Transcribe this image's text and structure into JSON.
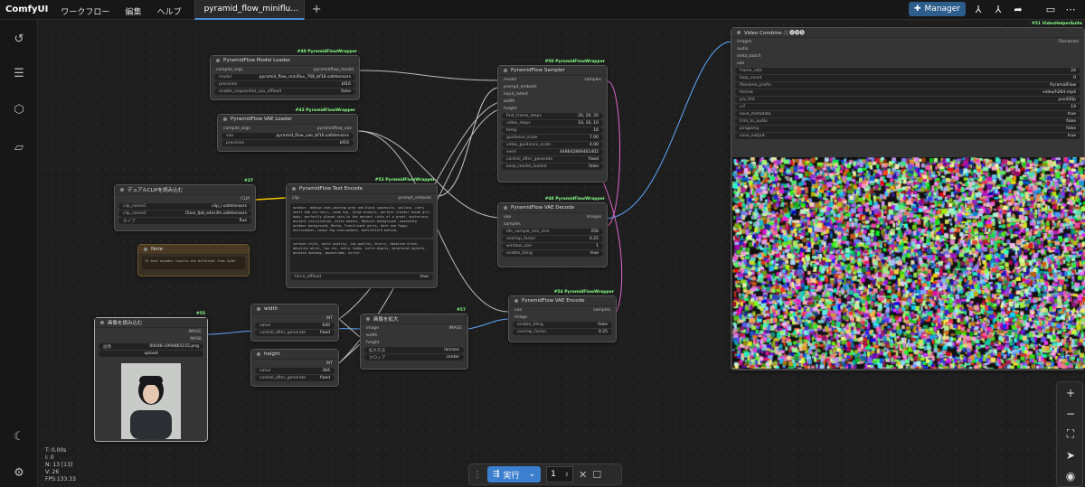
{
  "app": {
    "logo": "ComfyUI",
    "menu": [
      "ワークフロー",
      "編集",
      "ヘルプ"
    ],
    "tab": "pyramid_flow_miniflu…",
    "manager": "Manager"
  },
  "stats": {
    "t": "T: 0.00s",
    "i": "I: 0",
    "n": "N: 13 [13]",
    "v": "V: 26",
    "fps": "FPS:133.33"
  },
  "run": {
    "label": "実行",
    "count": "1"
  },
  "nodes": {
    "model_loader": {
      "badge": "#40 PyramidFlowWrapper",
      "title": "PyramidFlow Model Loader",
      "in": "compile_args",
      "out": "pyramidflow_model",
      "w": [
        [
          "model",
          "pyramid_flow_miniflux_768_bf16.safetensors"
        ],
        [
          "precision",
          "bf16"
        ],
        [
          "enable_sequential_cpu_offload",
          "false"
        ]
      ]
    },
    "vae_loader": {
      "badge": "#43 PyramidFlowWrapper",
      "title": "PyramidFlow VAE Loader",
      "in": "compile_args",
      "out": "pyramidflow_vae",
      "w": [
        [
          "vae",
          "pyramid_flow_vae_bf16.safetensors"
        ],
        [
          "precision",
          "bf16"
        ]
      ]
    },
    "clip": {
      "badge": "#37",
      "title": "デュアルCLIPを読み込む",
      "out": "CLIP",
      "w": [
        [
          "clip_name1",
          "clip_l.safetensors"
        ],
        [
          "clip_name2",
          "t5xxl_fp8_e4m3fn.safetensors"
        ],
        [
          "タイプ",
          "flux"
        ]
      ]
    },
    "note": {
      "title": "Note",
      "text": "T5 text encoder results are different from fp16!"
    },
    "text_encode": {
      "badge": "#53 PyramidFlowWrapper",
      "title": "PyramidFlow Text Encode",
      "in": "clip",
      "out": "prompt_embeds",
      "pos": "outdoor, medium shot,wearing grey and black spaceuits, smiling, (very short bob cut hair), wide hip, large breasts, perfect slender anime girl body, perfectly placed skin,in the ancient ruins of a great, mysterious ancient civilization, alien beasts, Machine background ,spaceship outdoor background, Mecha, Translucent parts, dark and foggy environment, heavy fog environment, battlefield behind,",
      "neg": "cartoon style, worst quality, low quality, blurry, absolute black, absolute white, low res, extra limbs, extra digits, misplaced objects, mutated anatomy, monochrome, horror",
      "w": [
        [
          "force_offload",
          "true"
        ]
      ]
    },
    "sampler": {
      "badge": "#50 PyramidFlowWrapper",
      "title": "PyramidFlow Sampler",
      "ins": [
        "model",
        "prompt_embeds",
        "input_latent",
        "width",
        "height"
      ],
      "out": "samples",
      "w": [
        [
          "first_frame_steps",
          "20, 20, 20"
        ],
        [
          "video_steps",
          "10, 10, 10"
        ],
        [
          "temp",
          "16"
        ],
        [
          "guidance_scale",
          "7.00"
        ],
        [
          "video_guidance_scale",
          "4.00"
        ],
        [
          "seed",
          "448642866461402"
        ],
        [
          "control_after_generate",
          "fixed"
        ],
        [
          "keep_model_loaded",
          "false"
        ]
      ]
    },
    "vae_decode": {
      "badge": "#48 PyramidFlowWrapper",
      "title": "PyramidFlow VAE Decode",
      "ins": [
        "vae",
        "samples"
      ],
      "out": "images",
      "w": [
        [
          "tile_sample_min_size",
          "256"
        ],
        [
          "overlap_factor",
          "0.25"
        ],
        [
          "window_size",
          "1"
        ],
        [
          "enable_tiling",
          "true"
        ]
      ]
    },
    "vae_encode": {
      "badge": "#54 PyramidFlowWrapper",
      "title": "PyramidFlow VAE Encode",
      "ins": [
        "vae",
        "image"
      ],
      "out": "samples",
      "w": [
        [
          "enable_tiling",
          "false"
        ],
        [
          "overlap_factor",
          "0.25"
        ]
      ]
    },
    "load_image": {
      "badge": "#55",
      "title": "画像を読み込む",
      "outs": [
        "IMAGE",
        "MASK"
      ],
      "w": [
        [
          "画像",
          "00048-1994865155.png"
        ]
      ],
      "upload": "upload"
    },
    "width": {
      "title": "width",
      "out": "INT",
      "w": [
        [
          "value",
          "640"
        ],
        [
          "control_after_generate",
          "fixed"
        ]
      ]
    },
    "height": {
      "title": "height",
      "out": "INT",
      "w": [
        [
          "value",
          "384"
        ],
        [
          "control_after_generate",
          "fixed"
        ]
      ]
    },
    "upscale": {
      "badge": "#57",
      "title": "画像を拡大",
      "ins": [
        "image",
        "width",
        "height"
      ],
      "out": "IMAGE",
      "w": [
        [
          "拡大方法",
          "lanczos"
        ],
        [
          "クロップ",
          "center"
        ]
      ]
    },
    "video": {
      "badge": "#51 VideoHelperSuite",
      "title": "Video Combine 🎥🅥🅗🅢",
      "ins": [
        "images",
        "audio",
        "meta_batch",
        "vae"
      ],
      "out": "Filenames",
      "w": [
        [
          "frame_rate",
          "24"
        ],
        [
          "loop_count",
          "0"
        ],
        [
          "filename_prefix",
          "PyramidFlow"
        ],
        [
          "format",
          "video/h264-mp4"
        ],
        [
          "pix_fmt",
          "yuv420p"
        ],
        [
          "crf",
          "19"
        ],
        [
          "save_metadata",
          "true"
        ],
        [
          "trim_to_audio",
          "false"
        ],
        [
          "pingpong",
          "false"
        ],
        [
          "save_output",
          "true"
        ]
      ]
    }
  }
}
